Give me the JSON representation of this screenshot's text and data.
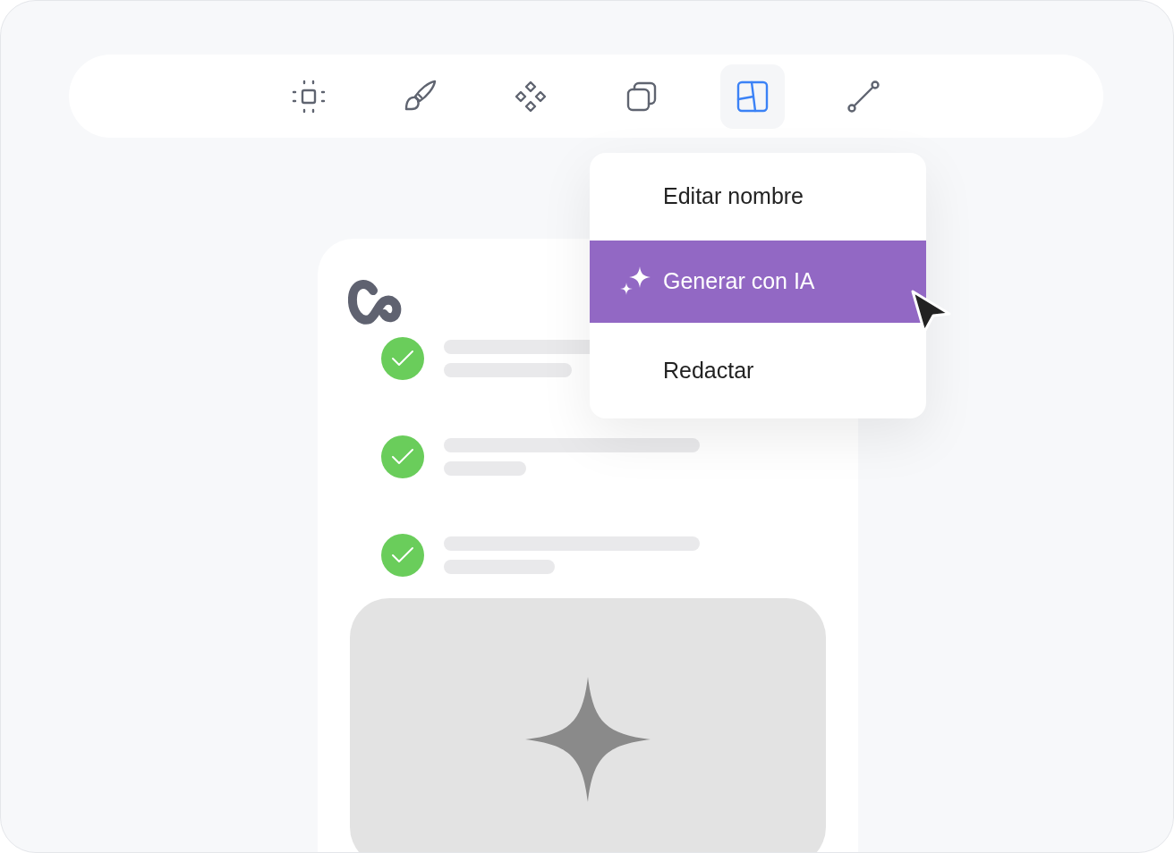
{
  "toolbar": {
    "tools": [
      {
        "kind": "frame",
        "selected": false
      },
      {
        "kind": "brush",
        "selected": false
      },
      {
        "kind": "components",
        "selected": false
      },
      {
        "kind": "layers",
        "selected": false
      },
      {
        "kind": "layout",
        "selected": true
      },
      {
        "kind": "line",
        "selected": false
      }
    ]
  },
  "menu": {
    "items": [
      {
        "label": "Editar nombre",
        "selected": false,
        "kind": "plain"
      },
      {
        "label": "Generar con IA",
        "selected": true,
        "kind": "ai"
      },
      {
        "label": "Redactar",
        "selected": false,
        "kind": "plain"
      }
    ]
  },
  "checklist": [
    {
      "checked": true
    },
    {
      "checked": true
    },
    {
      "checked": true
    }
  ]
}
